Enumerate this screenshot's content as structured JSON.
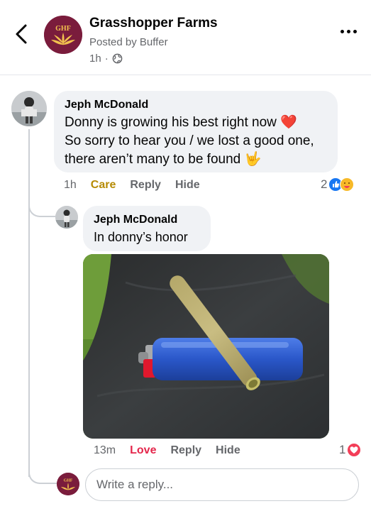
{
  "header": {
    "page_name": "Grasshopper Farms",
    "posted_by": "Posted by Buffer",
    "time": "1h",
    "separator": "·",
    "logo_text": "GHF"
  },
  "comment": {
    "author": "Jeph McDonald",
    "lines": [
      "Donny is growing his best right now ❤️",
      "So sorry to hear you / we lost a good one,",
      "there aren’t many to be found 🤟"
    ],
    "time": "1h",
    "reaction_label": "Care",
    "reply_label": "Reply",
    "hide_label": "Hide",
    "reaction_count": "2",
    "reaction_icons": [
      "like-icon",
      "care-icon"
    ]
  },
  "reply": {
    "author": "Jeph McDonald",
    "text": "In donny’s honor",
    "time": "13m",
    "reaction_label": "Love",
    "reply_label": "Reply",
    "hide_label": "Hide",
    "reaction_count": "1",
    "reaction_icons": [
      "love-icon"
    ]
  },
  "composer": {
    "placeholder": "Write a reply...",
    "logo_text": "GHF"
  },
  "colors": {
    "brand": "#7a1c3c",
    "care": "#b68b04",
    "love": "#e4264b",
    "like": "#1877f2",
    "muted": "#65676b"
  }
}
